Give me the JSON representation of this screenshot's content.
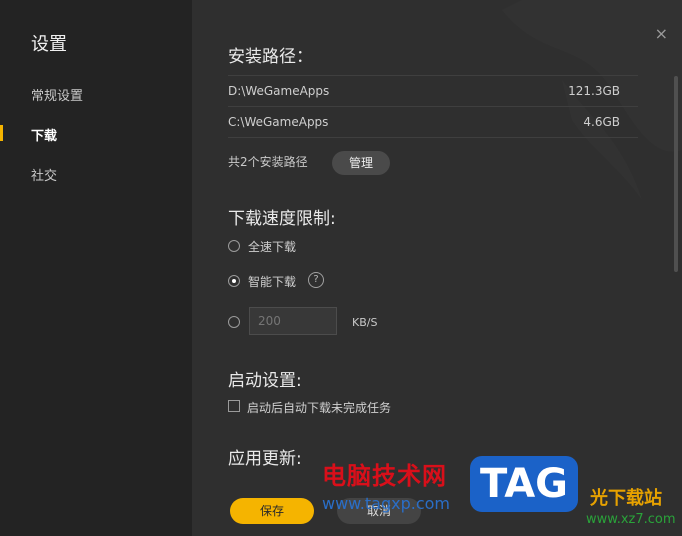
{
  "sidebar": {
    "title": "设置",
    "items": [
      {
        "label": "常规设置",
        "active": false
      },
      {
        "label": "下载",
        "active": true
      },
      {
        "label": "社交",
        "active": false
      }
    ],
    "accent": "#f5b400"
  },
  "main": {
    "close_glyph": "×",
    "install_path": {
      "title": "安装路径：",
      "rows": [
        {
          "path": "D:\\WeGameApps",
          "size": "121.3GB"
        },
        {
          "path": "C:\\WeGameApps",
          "size": "4.6GB"
        }
      ],
      "summary": "共2个安装路径",
      "manage_label": "管理"
    },
    "download_speed": {
      "title": "下载速度限制:",
      "options": [
        {
          "label": "全速下载",
          "selected": false
        },
        {
          "label": "智能下载",
          "selected": true
        },
        {
          "label": "",
          "selected": false
        }
      ],
      "help_glyph": "?",
      "speed_placeholder": "200",
      "unit": "KB/S"
    },
    "startup": {
      "title": "启动设置:",
      "checkbox_label": "启动后自动下载未完成任务",
      "checked": false
    },
    "update": {
      "title": "应用更新:"
    },
    "buttons": {
      "save": "保存",
      "cancel": "取消"
    }
  },
  "watermark": {
    "site_name": "电脑技术网",
    "site_url": "www.tagxp.com",
    "logo_text": "TAG",
    "site2_name": "光下载站",
    "site2_url": "www.xz7.com"
  }
}
